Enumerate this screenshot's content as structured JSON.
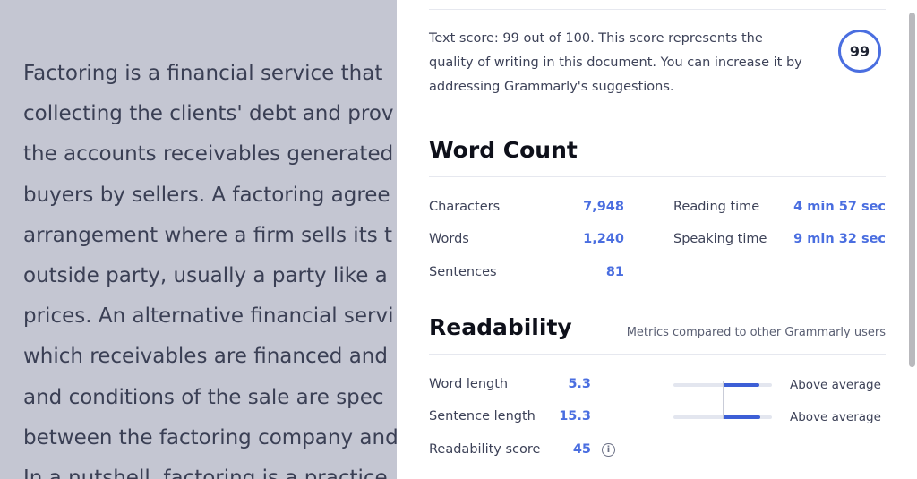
{
  "document": {
    "lines": [
      "Factoring is a financial service that",
      "collecting the clients' debt and prov",
      "the accounts receivables generated",
      "buyers by sellers. A factoring agree",
      "arrangement where a firm sells its t",
      "outside party, usually a party like a",
      "prices. An alternative financial servi",
      "which receivables are financed and",
      "and conditions of the sale are spec",
      "between the factoring company and",
      "In a nutshell, factoring is a practice"
    ]
  },
  "score": {
    "text": "Text score: 99 out of 100. This score represents the quality of writing in this document. You can increase it by addressing Grammarly's suggestions.",
    "value": "99"
  },
  "word_count": {
    "title": "Word Count",
    "left": [
      {
        "label": "Characters",
        "value": "7,948"
      },
      {
        "label": "Words",
        "value": "1,240"
      },
      {
        "label": "Sentences",
        "value": "81"
      }
    ],
    "right": [
      {
        "label": "Reading time",
        "value": "4 min 57 sec"
      },
      {
        "label": "Speaking time",
        "value": "9 min 32 sec"
      }
    ]
  },
  "readability": {
    "title": "Readability",
    "note": "Metrics compared to other Grammarly users",
    "rows": [
      {
        "label": "Word length",
        "value": "5.3",
        "assessment": "Above average",
        "bar_fill_start": 0.5,
        "bar_fill_end": 0.87
      },
      {
        "label": "Sentence length",
        "value": "15.3",
        "assessment": "Above average",
        "bar_fill_start": 0.5,
        "bar_fill_end": 0.88
      },
      {
        "label": "Readability score",
        "value": "45"
      }
    ],
    "info_icon": "info-icon"
  },
  "colors": {
    "accent": "#4a6ee0",
    "bar_fill": "#3d5fd6",
    "overlay_bg": "#c4c6d2"
  }
}
